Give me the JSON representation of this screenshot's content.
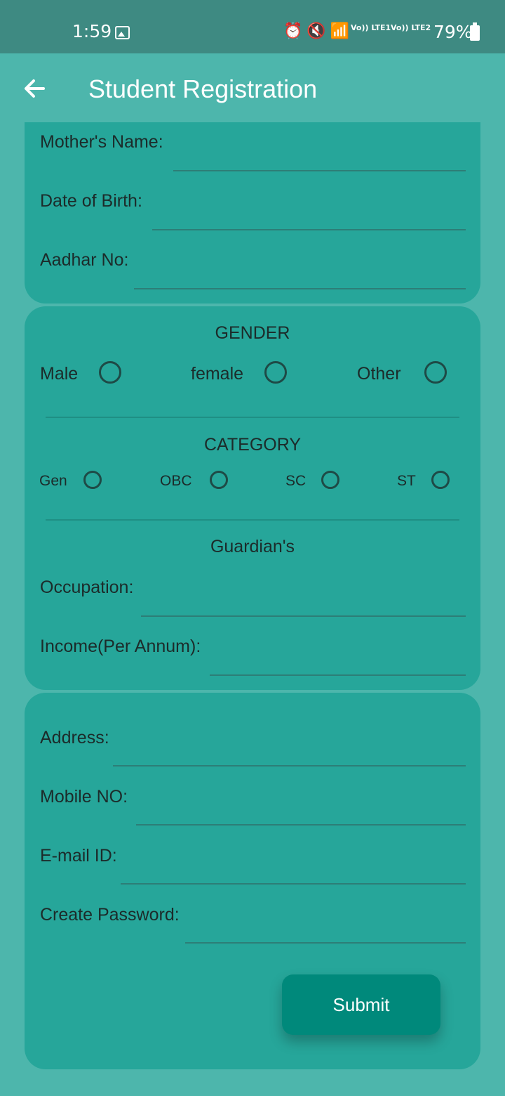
{
  "status_bar": {
    "time": "1:59",
    "lte1": "Vo)) LTE1",
    "lte2": "Vo)) LTE2",
    "battery": "79%",
    "icons": [
      "gallery-icon",
      "alarm-icon",
      "mute-icon",
      "wifi-icon",
      "signal-icon",
      "battery-icon"
    ]
  },
  "app_bar": {
    "title": "Student Registration",
    "back_icon": "back-arrow-icon"
  },
  "personal": {
    "mothers_name_label": "Mother's Name:",
    "mothers_name_value": "",
    "dob_label": "Date of Birth:",
    "dob_value": "",
    "aadhar_label": "Aadhar No:",
    "aadhar_value": ""
  },
  "gender": {
    "title": "GENDER",
    "options": [
      "Male",
      "female",
      "Other"
    ]
  },
  "category": {
    "title": "CATEGORY",
    "options": [
      "Gen",
      "OBC",
      "SC",
      "ST"
    ]
  },
  "guardian": {
    "title": "Guardian's",
    "occupation_label": "Occupation:",
    "occupation_value": "",
    "income_label": "Income(Per Annum):",
    "income_value": ""
  },
  "contact": {
    "address_label": "Address:",
    "mobile_label": "Mobile NO:",
    "email_label": "E-mail ID:",
    "password_label": "Create Password:"
  },
  "submit_label": "Submit",
  "colors": {
    "background": "#4db6ac",
    "status_bar": "#3e8a82",
    "card": "#26a69a",
    "button": "#00897b",
    "text": "#1c2b2a"
  }
}
